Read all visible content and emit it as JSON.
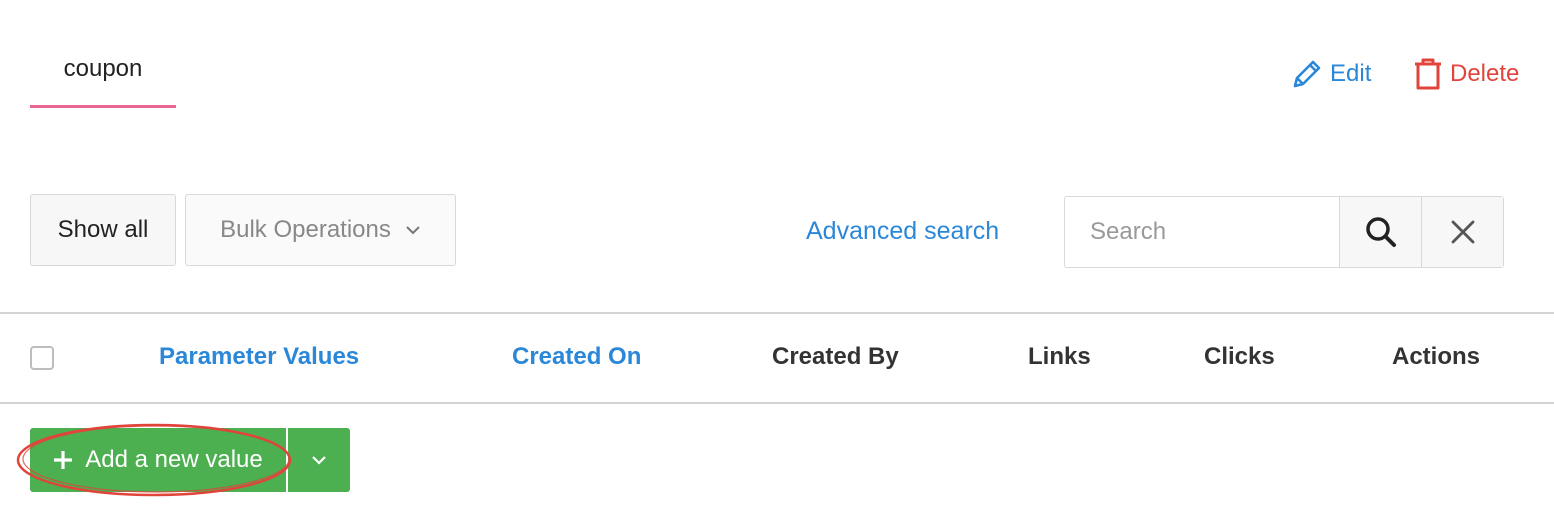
{
  "tab": {
    "label": "coupon"
  },
  "header_actions": {
    "edit_label": "Edit",
    "delete_label": "Delete"
  },
  "toolbar": {
    "show_all_label": "Show all",
    "bulk_operations_label": "Bulk Operations",
    "advanced_search_label": "Advanced search"
  },
  "search": {
    "placeholder": "Search",
    "value": ""
  },
  "table": {
    "columns": [
      "Parameter Values",
      "Created On",
      "Created By",
      "Links",
      "Clicks",
      "Actions"
    ]
  },
  "add_button": {
    "label": "Add a new value"
  },
  "icons": {
    "edit": "pencil-icon",
    "delete": "trash-icon",
    "dropdown": "chevron-down-icon",
    "search": "search-icon",
    "clear": "close-icon",
    "add": "plus-icon"
  },
  "colors": {
    "accent_blue": "#2b87d8",
    "danger_red": "#e0443a",
    "tab_underline": "#e8668f",
    "success_green": "#4caf50",
    "annotation_red": "#e0443a"
  }
}
